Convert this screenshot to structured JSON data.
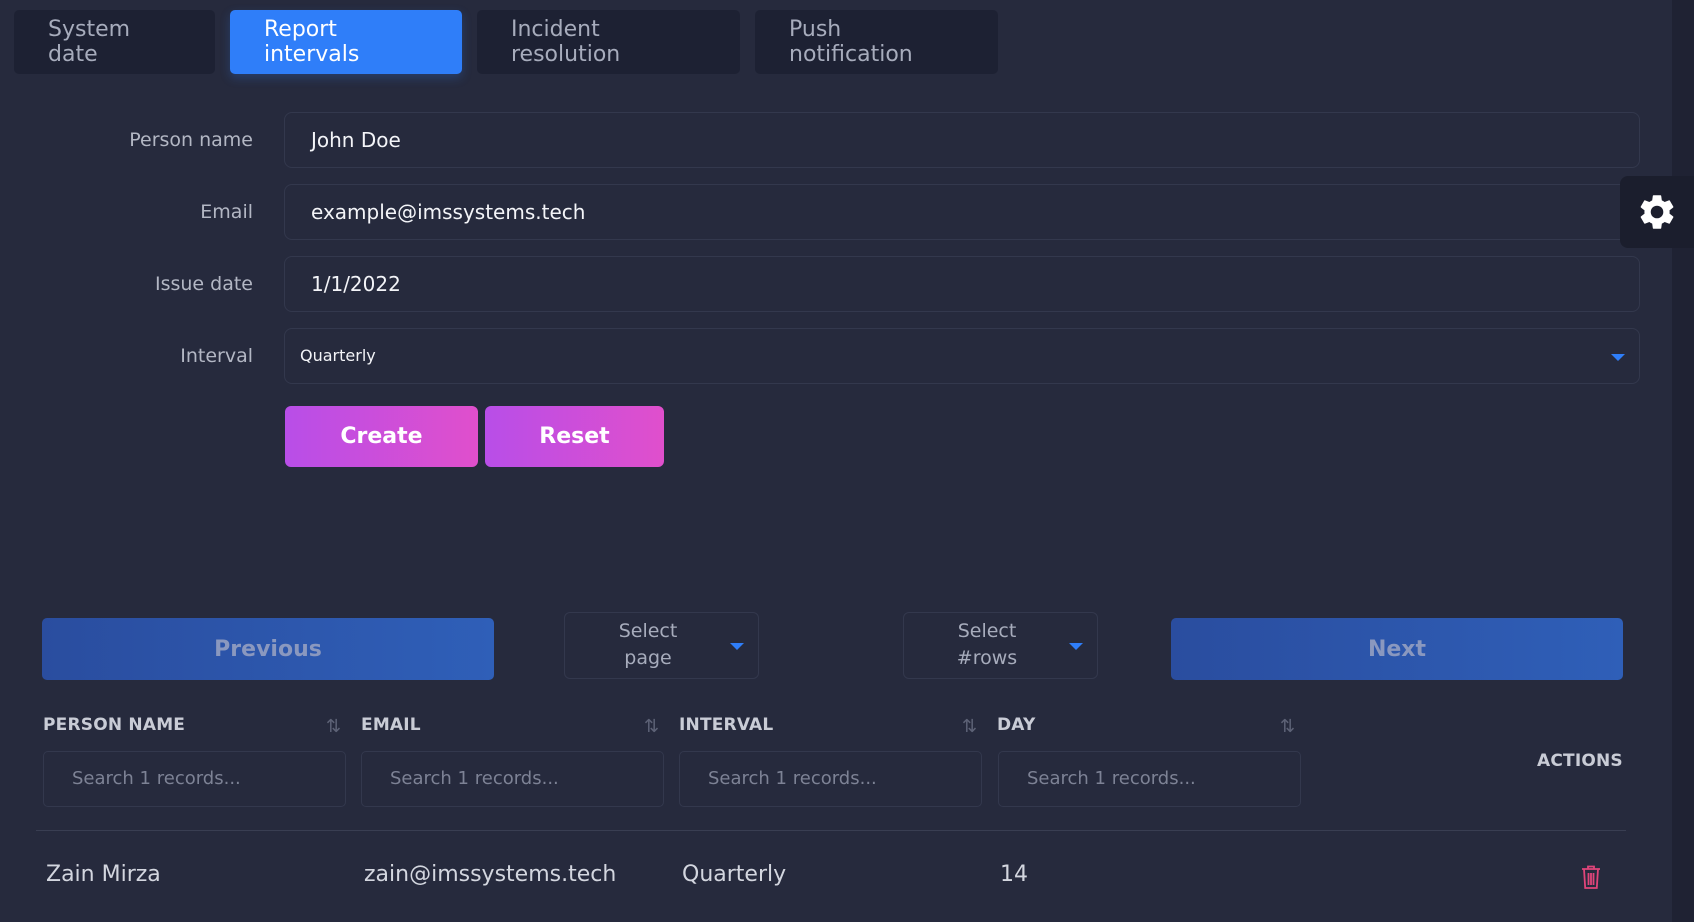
{
  "tabs": [
    {
      "label": "System date",
      "active": false
    },
    {
      "label": "Report intervals",
      "active": true
    },
    {
      "label": "Incident resolution",
      "active": false
    },
    {
      "label": "Push notification",
      "active": false
    }
  ],
  "form": {
    "person_name_label": "Person name",
    "person_name_value": "John Doe",
    "email_label": "Email",
    "email_value": "example@imssystems.tech",
    "issue_date_label": "Issue date",
    "issue_date_value": "1/1/2022",
    "interval_label": "Interval",
    "interval_value": "Quarterly",
    "create_label": "Create",
    "reset_label": "Reset"
  },
  "pagination": {
    "previous_label": "Previous",
    "next_label": "Next",
    "select_page_label": "Select\npage",
    "select_rows_label": "Select\n#rows"
  },
  "table": {
    "columns": [
      "PERSON NAME",
      "EMAIL",
      "INTERVAL",
      "DAY"
    ],
    "actions_label": "ACTIONS",
    "search_placeholder": "Search 1 records...",
    "rows": [
      {
        "person_name": "Zain Mirza",
        "email": "zain@imssystems.tech",
        "interval": "Quarterly",
        "day": "14"
      }
    ]
  },
  "colors": {
    "background": "#262a3d",
    "accent": "#2f7ef9",
    "gradient_start": "#b84ee8",
    "gradient_end": "#e04fcc",
    "delete": "#e0457a"
  },
  "icons": {
    "settings": "gear-icon",
    "sort": "sort-icon",
    "delete": "trash-icon",
    "dropdown": "caret-down-icon"
  }
}
